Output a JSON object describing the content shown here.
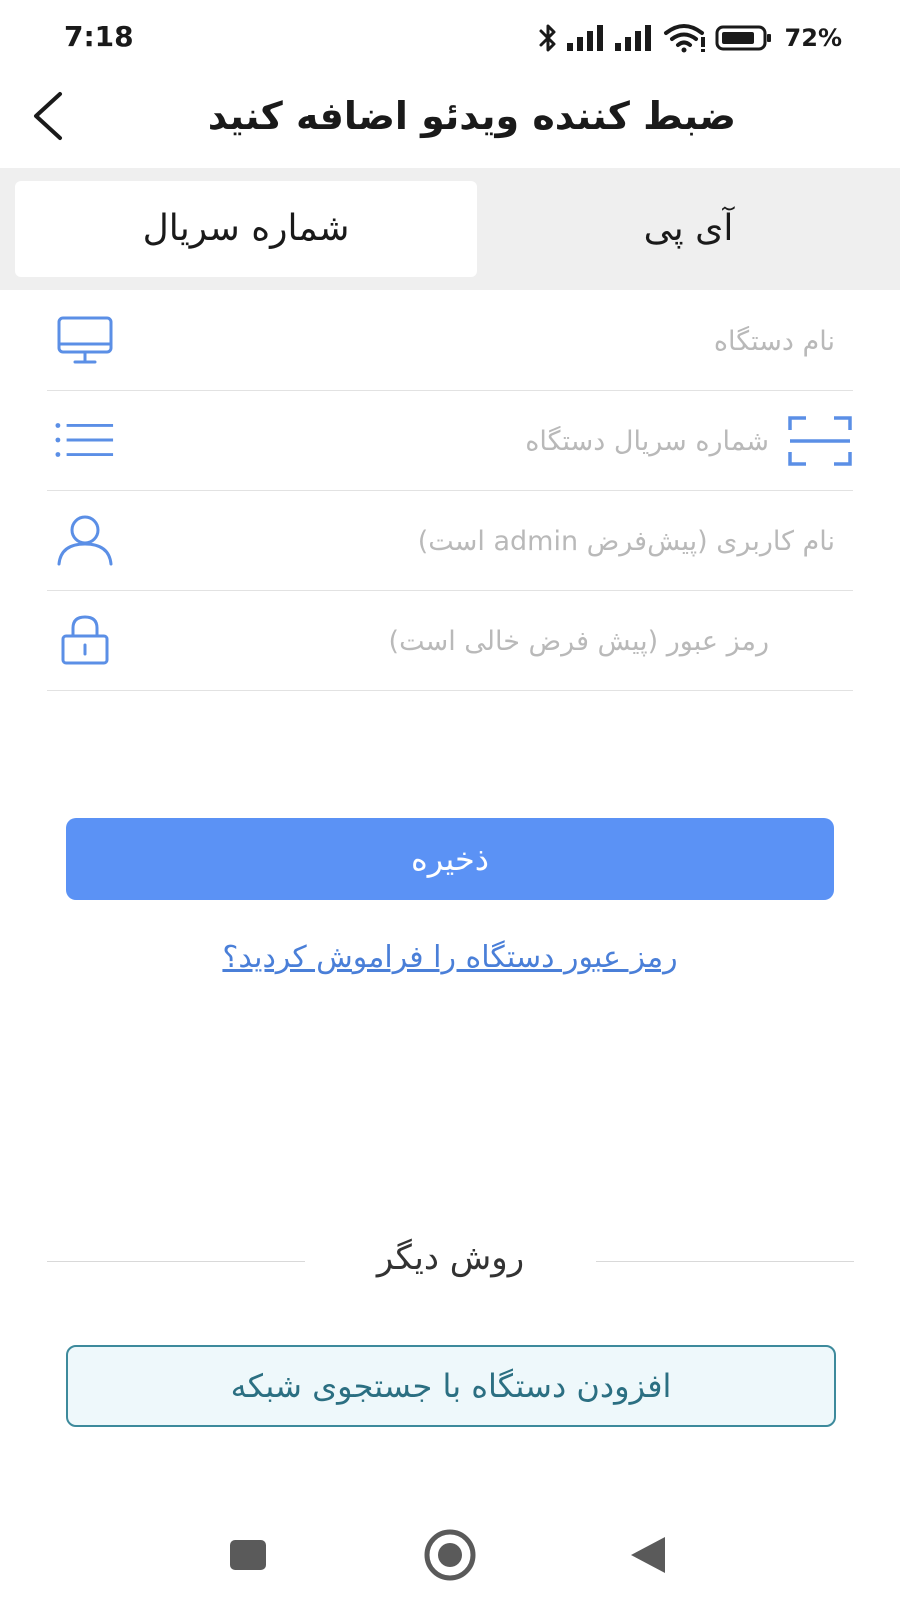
{
  "status_bar": {
    "time": "7:18",
    "battery_percent": "72%",
    "icons": [
      "bluetooth-icon",
      "signal-icon",
      "signal-icon",
      "wifi-icon",
      "battery-icon"
    ]
  },
  "header": {
    "title": "ضبط کننده ویدئو اضافه کنید",
    "back_icon": "chevron-left-icon"
  },
  "tabs": [
    {
      "label": "شماره سریال",
      "selected": true
    },
    {
      "label": "آی پی",
      "selected": false
    }
  ],
  "form": {
    "device_name": {
      "placeholder": "نام دستگاه",
      "value": "",
      "icon": "monitor-icon"
    },
    "serial_number": {
      "placeholder": "شماره سریال دستگاه",
      "value": "",
      "icon": "list-icon",
      "action_icon": "scan-icon"
    },
    "username": {
      "placeholder": "نام کاربری (پیش‌فرض admin است)",
      "value": "",
      "icon": "user-icon"
    },
    "password": {
      "placeholder": "رمز عبور (پیش فرض خالی است)",
      "value": "",
      "icon": "lock-icon"
    }
  },
  "actions": {
    "save_label": "ذخیره",
    "forgot_password": "رمز عبور دستگاه را فراموش کردید؟",
    "other_method": "روش دیگر",
    "network_search_label": "افزودن دستگاه با جستجوی شبکه"
  },
  "colors": {
    "accent": "#5b92f5",
    "link": "#4a7fd8",
    "icon": "#5b8fe6",
    "network_button_border": "#3d8a9c",
    "network_button_bg": "#eef8fb"
  },
  "nav_bar": {
    "icons": [
      "recent-apps-icon",
      "home-icon",
      "back-icon"
    ]
  }
}
